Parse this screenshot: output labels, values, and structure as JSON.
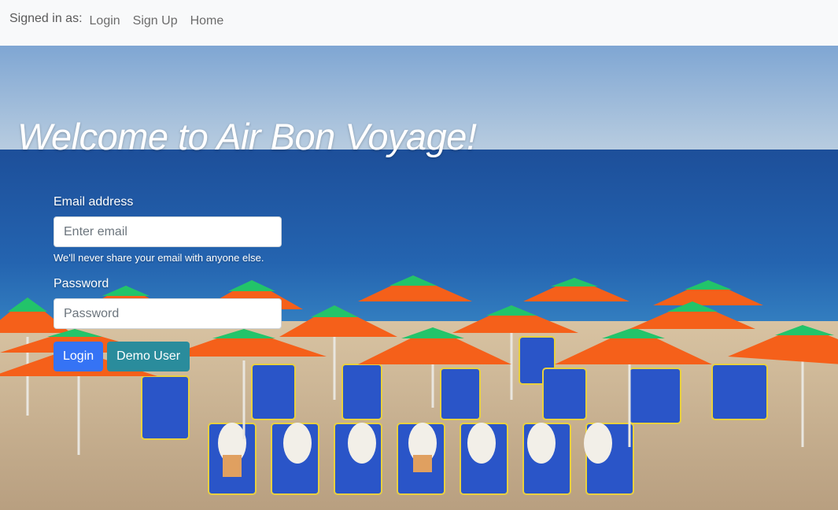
{
  "navbar": {
    "signed_in_label": "Signed in as:",
    "links": [
      "Login",
      "Sign Up",
      "Home"
    ]
  },
  "hero": {
    "title": "Welcome to Air Bon Voyage!",
    "background_description_icon": "beach-photo"
  },
  "form": {
    "email_label": "Email address",
    "email_placeholder": "Enter email",
    "email_help": "We'll never share your email with anyone else.",
    "password_label": "Password",
    "password_placeholder": "Password",
    "login_button": "Login",
    "demo_button": "Demo User"
  },
  "colors": {
    "primary": "#3573f5",
    "info": "#2a8c9c",
    "sky": "#8fb3d8",
    "sea": "#1f5aa6",
    "sand": "#c9b497",
    "umbrella_orange": "#f5601a",
    "umbrella_green": "#22c46a"
  }
}
